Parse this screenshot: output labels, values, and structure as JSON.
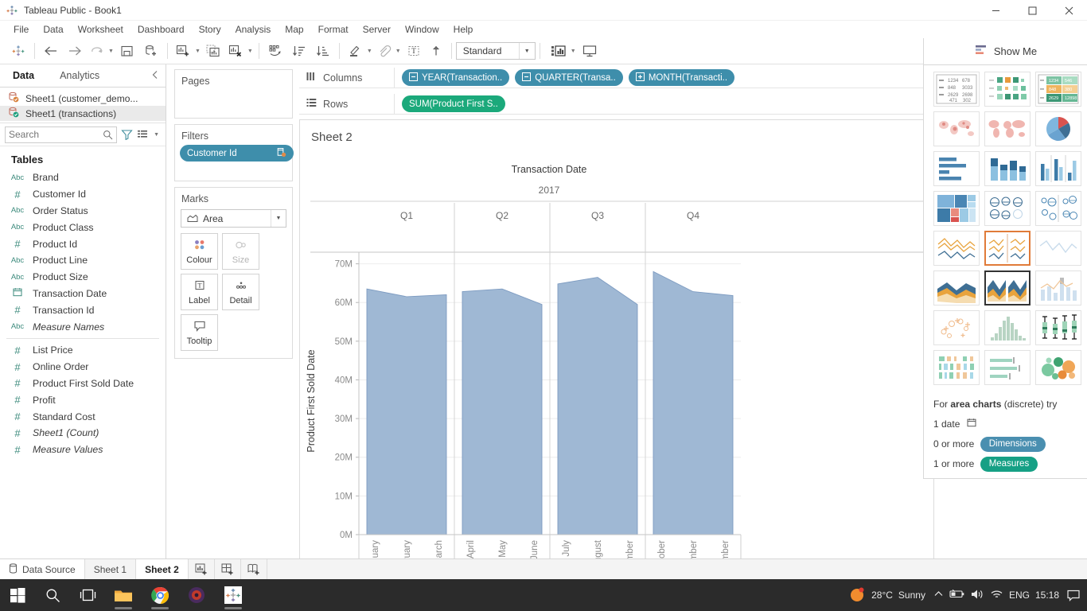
{
  "window": {
    "title": "Tableau Public - Book1",
    "app_icon": "tableau-icon",
    "minimize": "─",
    "maximize": "☐",
    "close": "✕"
  },
  "menubar": {
    "items": [
      "File",
      "Data",
      "Worksheet",
      "Dashboard",
      "Story",
      "Analysis",
      "Map",
      "Format",
      "Server",
      "Window",
      "Help"
    ]
  },
  "toolbar": {
    "fit_value": "Standard",
    "items": [
      {
        "name": "tableau-logo-button"
      },
      {
        "name": "back-button"
      },
      {
        "name": "forward-button"
      },
      {
        "name": "refresh-data-source-button"
      },
      {
        "name": "save-button"
      },
      {
        "name": "new-data-source-button"
      },
      {
        "name": "new-worksheet-button"
      },
      {
        "name": "duplicate-sheet-button"
      },
      {
        "name": "clear-sheet-button"
      },
      {
        "name": "swap-rows-and-columns-button"
      },
      {
        "name": "sort-ascending-button"
      },
      {
        "name": "sort-descending-button"
      },
      {
        "name": "highlight-button"
      },
      {
        "name": "group-members-button"
      },
      {
        "name": "show-mark-labels-button"
      },
      {
        "name": "fix-axes-button"
      },
      {
        "name": "show-hide-cards-button"
      },
      {
        "name": "presentation-mode-button"
      }
    ]
  },
  "showme": {
    "button_label": "Show Me",
    "footer_prefix": "For",
    "footer_chart_type": "area charts",
    "footer_chart_qualifier": "(discrete) try",
    "req_date": "1 date",
    "req_dimensions_count": "0 or more",
    "req_dimensions_label": "Dimensions",
    "req_measures_count": "1 or more",
    "req_measures_label": "Measures",
    "thumbnails": [
      {
        "name": "text-table",
        "row": 0,
        "col": 0
      },
      {
        "name": "heat-map",
        "row": 0,
        "col": 1
      },
      {
        "name": "highlight-table",
        "row": 0,
        "col": 2
      },
      {
        "name": "symbol-maps",
        "row": 1,
        "col": 0
      },
      {
        "name": "filled-maps",
        "row": 1,
        "col": 1
      },
      {
        "name": "pie-charts",
        "row": 1,
        "col": 2
      },
      {
        "name": "horizontal-bars",
        "row": 2,
        "col": 0
      },
      {
        "name": "stacked-bars",
        "row": 2,
        "col": 1
      },
      {
        "name": "side-by-side-bars",
        "row": 2,
        "col": 2
      },
      {
        "name": "treemaps",
        "row": 3,
        "col": 0
      },
      {
        "name": "circle-views",
        "row": 3,
        "col": 1
      },
      {
        "name": "side-by-side-circles",
        "row": 3,
        "col": 2
      },
      {
        "name": "dual-combination",
        "row": 4,
        "col": 0
      },
      {
        "name": "lines-discrete",
        "row": 4,
        "col": 1
      },
      {
        "name": "lines-continuous",
        "row": 4,
        "col": 2
      },
      {
        "name": "area-charts-continuous",
        "row": 5,
        "col": 0
      },
      {
        "name": "area-charts-discrete",
        "row": 5,
        "col": 1
      },
      {
        "name": "dual-lines",
        "row": 5,
        "col": 2
      },
      {
        "name": "scatter-plots",
        "row": 6,
        "col": 0
      },
      {
        "name": "histogram",
        "row": 6,
        "col": 1
      },
      {
        "name": "box-and-whisker-plots",
        "row": 6,
        "col": 2
      },
      {
        "name": "gantt-charts",
        "row": 7,
        "col": 0
      },
      {
        "name": "bullet-graphs",
        "row": 7,
        "col": 1
      },
      {
        "name": "packed-bubbles",
        "row": 7,
        "col": 2
      }
    ]
  },
  "datapane": {
    "tabs": [
      {
        "label": "Data",
        "active": true
      },
      {
        "label": "Analytics",
        "active": false
      }
    ],
    "datasources": [
      {
        "label": "Sheet1 (customer_demo...",
        "selected": false
      },
      {
        "label": "Sheet1 (transactions)",
        "selected": true
      }
    ],
    "search_placeholder": "Search",
    "search_value": "",
    "section_header": "Tables",
    "fields": [
      {
        "label": "Brand",
        "type": "Abc",
        "italic": false
      },
      {
        "label": "Customer Id",
        "type": "#",
        "italic": false
      },
      {
        "label": "Order Status",
        "type": "Abc",
        "italic": false
      },
      {
        "label": "Product Class",
        "type": "Abc",
        "italic": false
      },
      {
        "label": "Product Id",
        "type": "#",
        "italic": false
      },
      {
        "label": "Product Line",
        "type": "Abc",
        "italic": false
      },
      {
        "label": "Product Size",
        "type": "Abc",
        "italic": false
      },
      {
        "label": "Transaction Date",
        "type": "date",
        "italic": false
      },
      {
        "label": "Transaction Id",
        "type": "#",
        "italic": false
      },
      {
        "label": "Measure Names",
        "type": "Abc",
        "italic": true
      }
    ],
    "measures": [
      {
        "label": "List Price",
        "type": "#",
        "italic": false
      },
      {
        "label": "Online Order",
        "type": "#",
        "italic": false
      },
      {
        "label": "Product First Sold Date",
        "type": "#",
        "italic": false
      },
      {
        "label": "Profit",
        "type": "#",
        "italic": false
      },
      {
        "label": "Standard Cost",
        "type": "#",
        "italic": false
      },
      {
        "label": "Sheet1 (Count)",
        "type": "#",
        "italic": true
      },
      {
        "label": "Measure Values",
        "type": "#",
        "italic": true
      }
    ]
  },
  "shelves": {
    "pages_label": "Pages",
    "filters_label": "Filters",
    "filter_pill": "Customer Id",
    "marks_label": "Marks",
    "marks_type": "Area",
    "marks_cards": [
      {
        "label": "Colour",
        "icon": "colour-icon",
        "dim": false
      },
      {
        "label": "Size",
        "icon": "size-icon",
        "dim": true
      },
      {
        "label": "Label",
        "icon": "label-icon",
        "dim": false
      },
      {
        "label": "Detail",
        "icon": "detail-icon",
        "dim": false
      },
      {
        "label": "Tooltip",
        "icon": "tooltip-icon",
        "dim": false
      }
    ],
    "columns_label": "Columns",
    "columns_pills": [
      "YEAR(Transaction..",
      "QUARTER(Transa..",
      "MONTH(Transacti.."
    ],
    "rows_label": "Rows",
    "rows_pills": [
      "SUM(Product First S.."
    ]
  },
  "viz": {
    "title": "Sheet 2"
  },
  "sheettabs": {
    "data_source": "Data Source",
    "tabs": [
      {
        "label": "Sheet 1",
        "active": false
      },
      {
        "label": "Sheet 2",
        "active": true
      }
    ],
    "new_buttons": [
      "new-worksheet-tab",
      "new-dashboard-tab",
      "new-story-tab"
    ]
  },
  "taskbar": {
    "start": "start-button",
    "search": "search-icon",
    "taskview": "task-view-icon",
    "apps": [
      "file-explorer-icon",
      "chrome-icon",
      "media-player-icon",
      "tableau-icon"
    ],
    "weather_temp": "28°C",
    "weather_desc": "Sunny",
    "language": "ENG",
    "clock": "15:18",
    "chevron": "∧"
  },
  "colors": {
    "area_fill": "#9fb8d4",
    "area_stroke": "#7d9bc1",
    "pill_blue": "#3e8eab",
    "pill_green": "#1ba97b",
    "accent_orange": "#e07b39"
  },
  "chart_data": {
    "type": "area",
    "title": "Sheet 2",
    "xlabel": "Transaction Date",
    "ylabel": "Product First Sold Date",
    "year": "2017",
    "quarters": [
      "Q1",
      "Q2",
      "Q3",
      "Q4"
    ],
    "categories": [
      "January",
      "February",
      "March",
      "April",
      "May",
      "June",
      "July",
      "August",
      "September",
      "October",
      "November",
      "December"
    ],
    "values": [
      63500000,
      61500000,
      62000000,
      62800000,
      63500000,
      59500000,
      64800000,
      66500000,
      59500000,
      68000000,
      62800000,
      61800000
    ],
    "ytick_labels": [
      "0M",
      "10M",
      "20M",
      "30M",
      "40M",
      "50M",
      "60M",
      "70M"
    ],
    "ytick_values": [
      0,
      10000000,
      20000000,
      30000000,
      40000000,
      50000000,
      60000000,
      70000000
    ],
    "ylim": [
      0,
      73000000
    ],
    "grid": true,
    "legend": "none",
    "series": [
      {
        "name": "SUM(Product First Sold Date)",
        "values": [
          63500000,
          61500000,
          62000000,
          62800000,
          63500000,
          59500000,
          64800000,
          66500000,
          59500000,
          68000000,
          62800000,
          61800000
        ]
      }
    ]
  }
}
